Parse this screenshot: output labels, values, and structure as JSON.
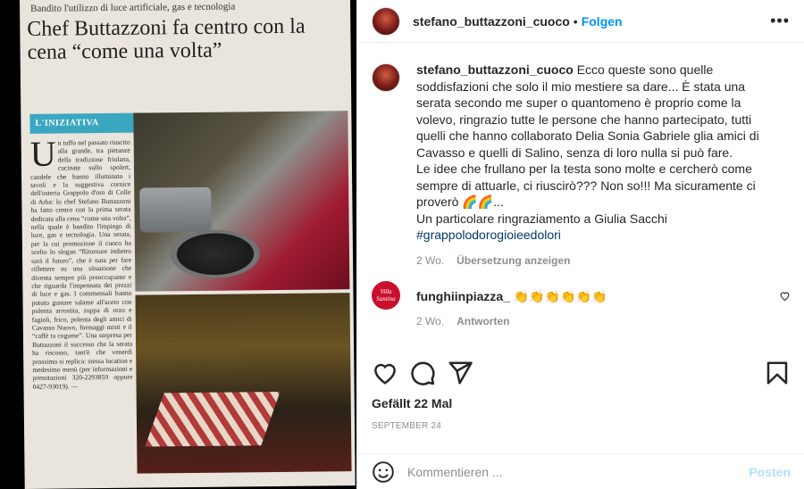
{
  "post": {
    "username": "stefano_buttazzoni_cuoco",
    "follow_label": "Folgen",
    "more_label": "•••"
  },
  "newspaper": {
    "kicker": "Bandito l'utilizzo di luce artificiale, gas e tecnologia",
    "title": "Chef Buttazzoni fa centro con la cena “come una volta”",
    "tag": "L'INIZIATIVA",
    "dropcap": "U",
    "body": "n tuffo nel passato riuscito alla grande, tra pietanze della tradizione friulana, cucinate sullo spolert, candele che hanno illuminato i tavoli e la suggestiva cornice dell'osteria Grappolo d'oro di Colle di Arba: lo chef Stefano Buttazzoni ha fatto centro con la prima serata dedicata alla cena “come una volta”, nella quale è bandito l'impiego di luce, gas e tecnologia. Una serata, per la cui promozione il cuoco ha scelto lo slogan “Ritornare indietro sarà il futuro”, che è nata per fare riflettere su una situazione che diventa sempre più preoccupante e che riguarda l'impennata dei prezzi di luce e gas. I commensali hanno potuto gustare salame all'aceto con polenta arrostita, zuppa di orzo e fagioli, frico, polenta degli amici di Cavasso Nuovo, formaggi misti e il “caffè ta cogume”. Una sorpresa per Buttazzoni il successo che la serata ha riscosso, tant'è che venerdì prossimo si replica: stessa location e medesimo menù (per informazioni e prenotazioni 320-2293859 oppure 0427-93019). —"
  },
  "caption": {
    "username": "stefano_buttazzoni_cuoco",
    "text": "Ecco queste sono quelle soddisfazioni che solo il mio mestiere sa dare... È stata una serata secondo me super o quantomeno è proprio come la volevo, ringrazio tutte le persone che hanno partecipato, tutti quelli che hanno collaborato Delia Sonia Gabriele glia amici di Cavasso e quelli di Salino, senza di loro nulla si può fare.",
    "text2": "Le idee che frullano per la testa sono molte e cercherò come sempre di attuarle, ci riuscirò??? Non so!!! Ma sicuramente ci proverò 🌈🌈...",
    "text3": "Un particolare ringraziamento a Giulia Sacchi",
    "hashtag": "#grappolodorogioieedolori",
    "time": "2 Wo.",
    "translate_label": "Übersetzung anzeigen"
  },
  "comment": {
    "username": "funghiinpiazza_",
    "avatar_text": "Villa Santina",
    "text": "👏👏👏👏👏👏",
    "time": "2 Wo.",
    "reply_label": "Antworten"
  },
  "footer": {
    "likes": "Gefällt 22 Mal",
    "date": "SEPTEMBER 24",
    "comment_placeholder": "Kommentieren ...",
    "post_label": "Posten"
  },
  "icons": [
    "heart-icon",
    "comment-icon",
    "share-icon",
    "bookmark-icon",
    "emoji-icon",
    "small-heart-icon",
    "more-icon"
  ]
}
